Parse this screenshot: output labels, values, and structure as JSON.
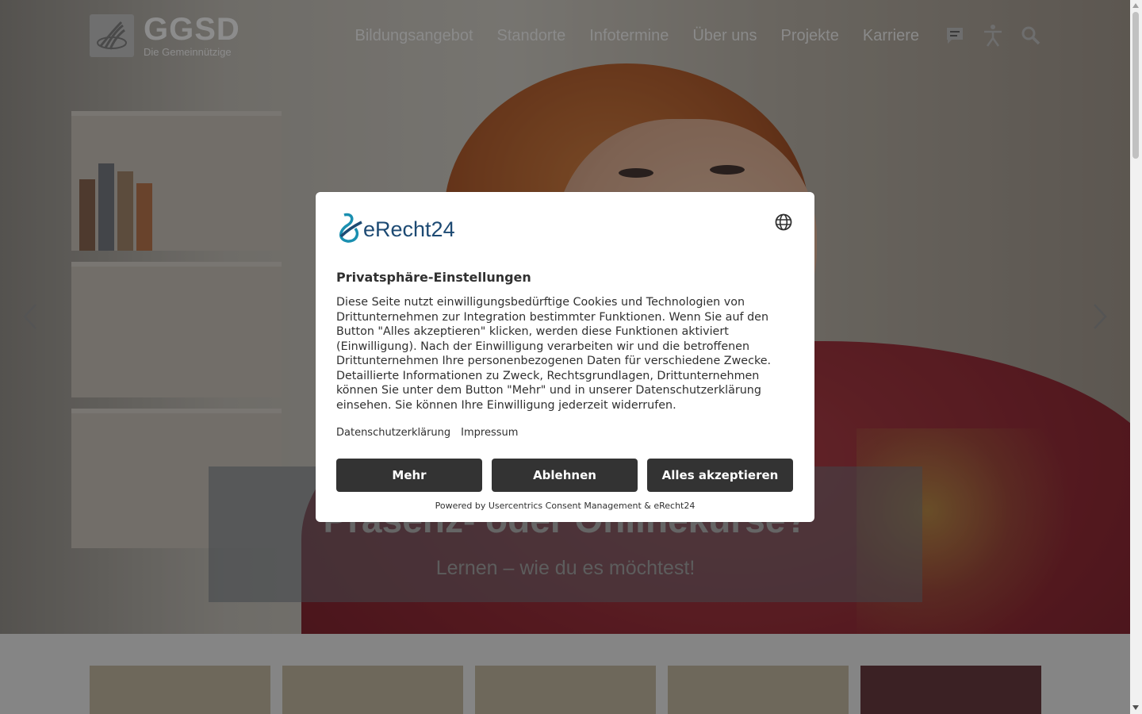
{
  "header": {
    "logo": {
      "name": "GGSD",
      "tagline": "Die Gemeinnützige"
    },
    "nav": [
      {
        "label": "Bildungsangebot"
      },
      {
        "label": "Standorte"
      },
      {
        "label": "Infotermine"
      },
      {
        "label": "Über uns"
      },
      {
        "label": "Projekte"
      },
      {
        "label": "Karriere"
      }
    ],
    "icons": [
      "chat-icon",
      "accessibility-icon",
      "search-icon"
    ]
  },
  "hero": {
    "title": "Präsenz- oder Onlinekurse?",
    "subtitle": "Lernen – wie du es möchtest!",
    "prev_icon": "chevron-left-icon",
    "next_icon": "chevron-right-icon"
  },
  "tiles": [
    {
      "color": "#c9bda6"
    },
    {
      "color": "#c9bda6"
    },
    {
      "color": "#c9bda6"
    },
    {
      "color": "#c9bda6"
    },
    {
      "color": "#6c3c42"
    }
  ],
  "consent": {
    "brand": "eRecht24",
    "language_icon": "globe-icon",
    "title": "Privatsphäre-Einstellungen",
    "text": "Diese Seite nutzt einwilligungsbedürftige Cookies und Technologien von Drittunternehmen zur Integration bestimmter Funktionen. Wenn Sie auf den Button \"Alles akzeptieren\" klicken, werden diese Funktionen aktiviert (Einwilligung). Nach der Einwilligung verarbeiten wir und die betroffenen Drittunternehmen Ihre personenbezogenen Daten für verschiedene Zwecke. Detaillierte Informationen zu Zweck, Rechtsgrundlagen, Drittunternehmen können Sie unter dem Button \"Mehr\" und in unserer Datenschutzerklärung einsehen. Sie können Ihre Einwilligung jederzeit widerrufen.",
    "links": {
      "privacy": "Datenschutzerklärung",
      "imprint": "Impressum"
    },
    "buttons": {
      "more": "Mehr",
      "decline": "Ablehnen",
      "accept_all": "Alles akzeptieren"
    },
    "powered_by": "Powered by Usercentrics Consent Management & eRecht24"
  },
  "colors": {
    "button_bg": "#333333",
    "brand_blue": "#1d4a73",
    "brand_teal": "#1a8fb0"
  }
}
